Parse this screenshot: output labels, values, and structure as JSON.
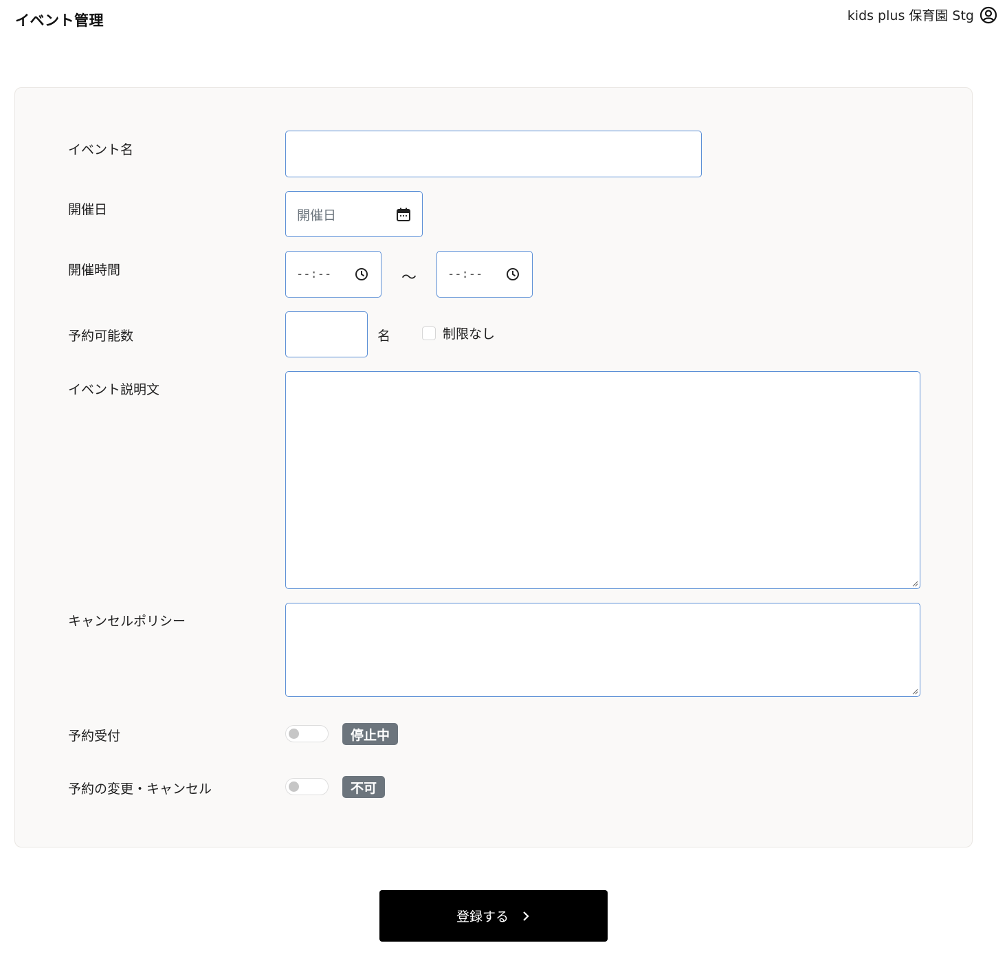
{
  "header": {
    "title": "イベント管理",
    "user_name": "kids plus 保育園 Stg",
    "user_icon": "user-circle-icon"
  },
  "form": {
    "event_name": {
      "label": "イベント名",
      "value": ""
    },
    "event_date": {
      "label": "開催日",
      "placeholder": "開催日",
      "icon": "calendar-icon"
    },
    "event_time": {
      "label": "開催時間",
      "start_value": "--:--",
      "end_value": "--:--",
      "separator": "～",
      "icon": "clock-icon"
    },
    "capacity": {
      "label": "予約可能数",
      "value": "",
      "unit": "名",
      "unlimited_label": "制限なし",
      "unlimited_checked": false
    },
    "description": {
      "label": "イベント説明文",
      "value": ""
    },
    "cancel_policy": {
      "label": "キャンセルポリシー",
      "value": ""
    },
    "reservation_acceptance": {
      "label": "予約受付",
      "toggle_on": false,
      "status": "停止中"
    },
    "reservation_change": {
      "label": "予約の変更・キャンセル",
      "toggle_on": false,
      "status": "不可"
    }
  },
  "submit": {
    "label": "登録する",
    "icon": "chevron-right-icon"
  },
  "colors": {
    "input_border": "#5b8fd6",
    "card_background": "#faf9f8",
    "badge_background": "#6c757d",
    "submit_background": "#000000"
  }
}
